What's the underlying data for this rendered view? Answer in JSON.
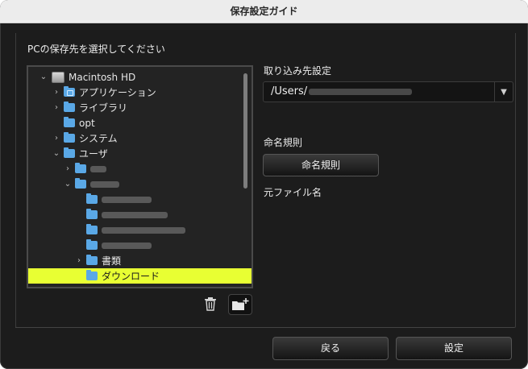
{
  "window": {
    "title": "保存設定ガイド"
  },
  "left": {
    "heading": "PCの保存先を選択してください",
    "tree": [
      {
        "label": "Macintosh HD",
        "expanded": true,
        "icon": "hard-drive-icon"
      },
      {
        "label": "アプリケーション",
        "expanded": false,
        "icon": "folder-icon"
      },
      {
        "label": "ライブラリ",
        "expanded": false,
        "icon": "folder-icon"
      },
      {
        "label": "opt",
        "expanded": false,
        "icon": "folder-icon"
      },
      {
        "label": "システム",
        "expanded": false,
        "icon": "folder-icon"
      },
      {
        "label": "ユーザ",
        "expanded": true,
        "icon": "folder-icon"
      },
      {
        "label": "",
        "expanded": false,
        "icon": "folder-icon"
      },
      {
        "label": "",
        "expanded": true,
        "icon": "home-folder-icon"
      },
      {
        "label": "",
        "expanded": false,
        "icon": "folder-icon"
      },
      {
        "label": "",
        "expanded": false,
        "icon": "folder-icon"
      },
      {
        "label": "",
        "expanded": false,
        "icon": "folder-icon"
      },
      {
        "label": "",
        "expanded": false,
        "icon": "folder-icon"
      },
      {
        "label": "書類",
        "expanded": false,
        "icon": "folder-icon"
      },
      {
        "label": "ダウンロード",
        "expanded": false,
        "icon": "folder-icon",
        "selected": true
      }
    ],
    "delete_icon": "trash-icon",
    "new_folder_icon": "new-folder-icon"
  },
  "right": {
    "destination_label": "取り込み先設定",
    "destination_value": "/Users/",
    "naming_label": "命名規則",
    "naming_button": "命名規則",
    "original_filename": "元ファイル名"
  },
  "footer": {
    "back_button": "戻る",
    "confirm_button": "設定"
  },
  "colors": {
    "selection": "#e8ff33",
    "folder": "#5aa8e6",
    "background": "#1c1c1c"
  }
}
